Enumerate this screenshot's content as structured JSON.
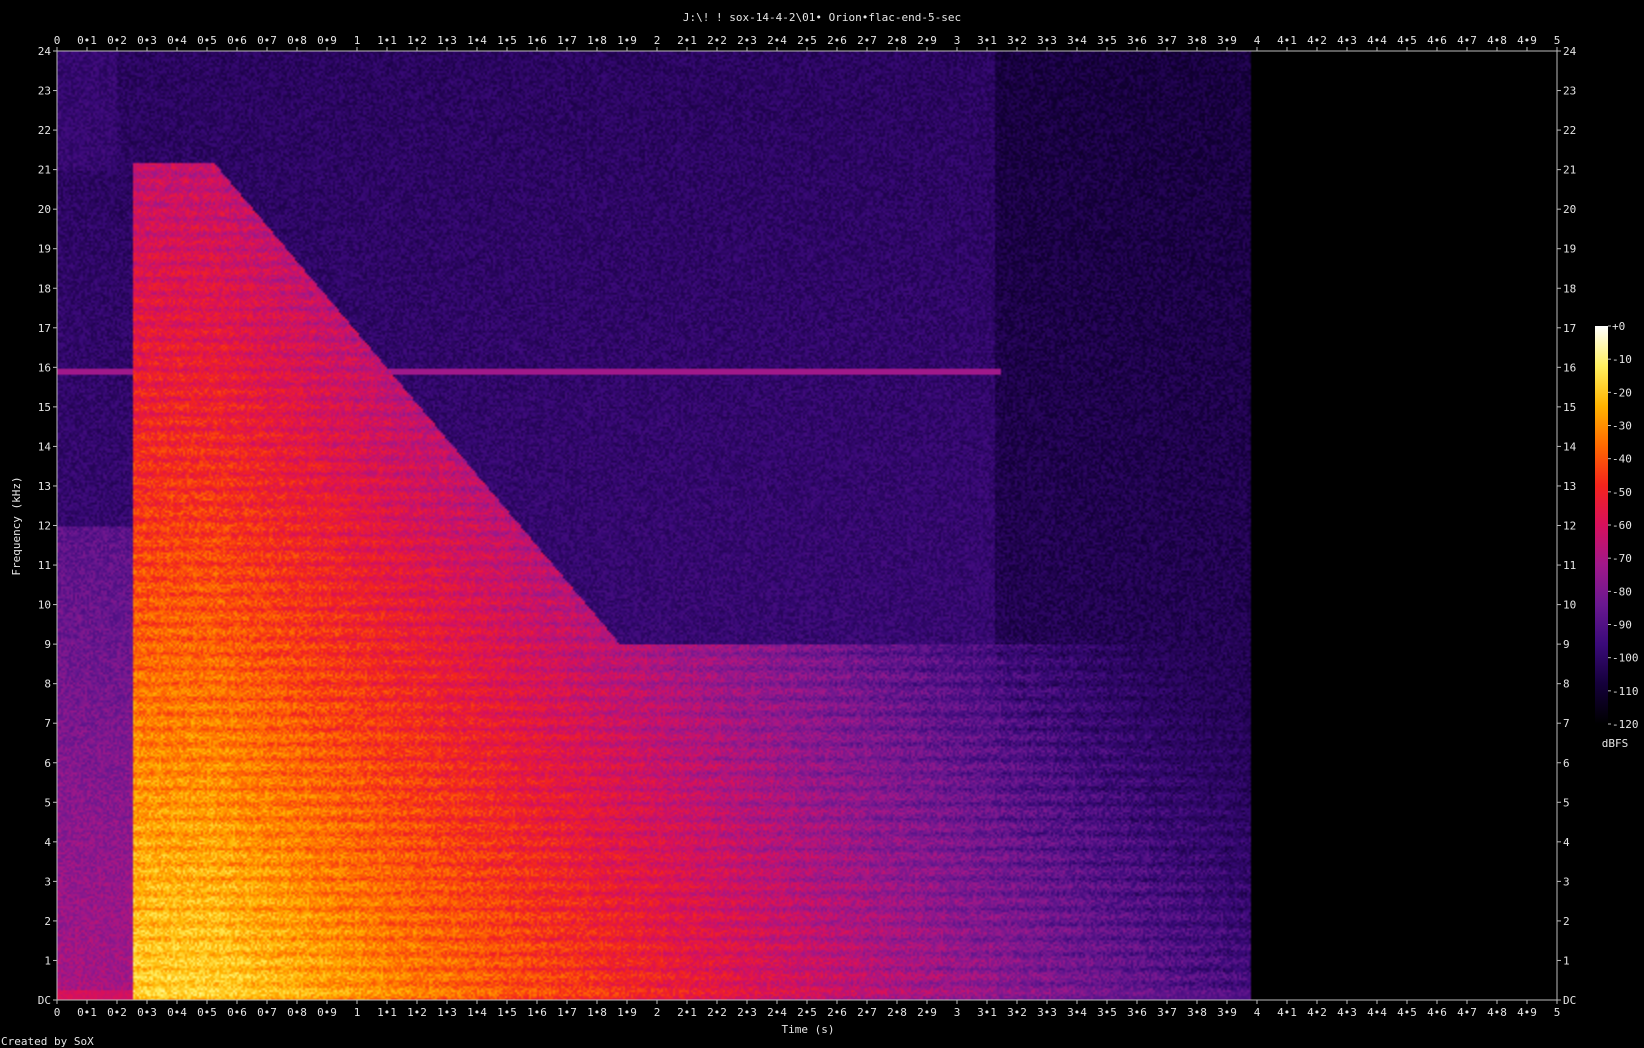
{
  "chart_data": {
    "type": "heatmap",
    "title": "J:\\! ! sox-14-4-2\\01• Orion•flac-end-5-sec",
    "xlabel": "Time (s)",
    "ylabel": "Frequency (kHz)",
    "credit": "Created by SoX",
    "xlim": [
      0,
      5
    ],
    "ylim": [
      0,
      24
    ],
    "x_ticks": [
      "0",
      "0•1",
      "0•2",
      "0•3",
      "0•4",
      "0•5",
      "0•6",
      "0•7",
      "0•8",
      "0•9",
      "1",
      "1•1",
      "1•2",
      "1•3",
      "1•4",
      "1•5",
      "1•6",
      "1•7",
      "1•8",
      "1•9",
      "2",
      "2•1",
      "2•2",
      "2•3",
      "2•4",
      "2•5",
      "2•6",
      "2•7",
      "2•8",
      "2•9",
      "3",
      "3•1",
      "3•2",
      "3•3",
      "3•4",
      "3•5",
      "3•6",
      "3•7",
      "3•8",
      "3•9",
      "4",
      "4•1",
      "4•2",
      "4•3",
      "4•4",
      "4•5",
      "4•6",
      "4•7",
      "4•8",
      "4•9",
      "5"
    ],
    "y_ticks": [
      "DC",
      "1",
      "2",
      "3",
      "4",
      "5",
      "6",
      "7",
      "8",
      "9",
      "10",
      "11",
      "12",
      "13",
      "14",
      "15",
      "16",
      "17",
      "18",
      "19",
      "20",
      "21",
      "22",
      "23",
      "24"
    ],
    "colorbar": {
      "label": "dBFS",
      "ticks": [
        "+0",
        "-10",
        "-20",
        "-30",
        "-40",
        "-50",
        "-60",
        "-70",
        "-80",
        "-90",
        "-100",
        "-110",
        "-120"
      ],
      "range": [
        -120,
        0
      ],
      "colors": [
        "#000000",
        "#14003a",
        "#3a0a7a",
        "#6a1890",
        "#a0188a",
        "#d8105c",
        "#f4241c",
        "#ff6a00",
        "#ffb400",
        "#fff060",
        "#ffffff"
      ]
    },
    "features": {
      "onset_s": 0.25,
      "sustain_end_s": 0.52,
      "tone_khz": 15.9,
      "tone_end_s": 3.15,
      "noise_end_s": 3.98,
      "noise_level_dbfs": -95,
      "peak_level_dbfs": -15
    }
  }
}
